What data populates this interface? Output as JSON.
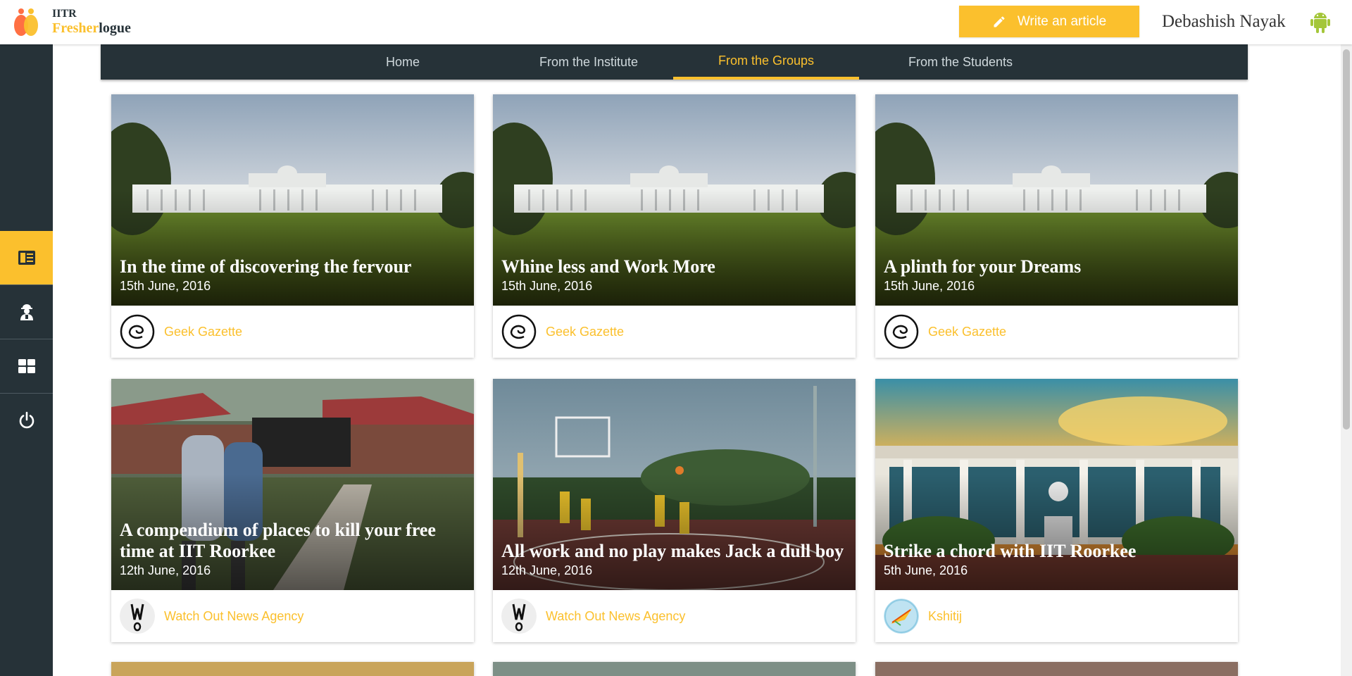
{
  "header": {
    "logo_top": "IITR",
    "logo_accent": "Fresher",
    "logo_rest": "logue",
    "write_label": "Write an article",
    "username": "Debashish Nayak"
  },
  "sidebar": {
    "items": [
      {
        "icon": "articles-icon",
        "active": true
      },
      {
        "icon": "agent-icon",
        "active": false
      },
      {
        "icon": "dashboard-icon",
        "active": false
      },
      {
        "icon": "power-icon",
        "active": false
      }
    ]
  },
  "nav": {
    "tabs": [
      {
        "label": "Home",
        "active": false
      },
      {
        "label": "From the Institute",
        "active": false
      },
      {
        "label": "From the Groups",
        "active": true
      },
      {
        "label": "From the Students",
        "active": false
      }
    ]
  },
  "cards": [
    {
      "title": "In the time of discovering the fervour",
      "date": "15th June, 2016",
      "group": "Geek Gazette"
    },
    {
      "title": "Whine less and Work More",
      "date": "15th June, 2016",
      "group": "Geek Gazette"
    },
    {
      "title": "A plinth for your Dreams",
      "date": "15th June, 2016",
      "group": "Geek Gazette"
    },
    {
      "title": "A compendium of places to kill your free time at IIT Roorkee",
      "date": "12th June, 2016",
      "group": "Watch Out News Agency"
    },
    {
      "title": "All work and no play makes Jack a dull boy",
      "date": "12th June, 2016",
      "group": "Watch Out News Agency"
    },
    {
      "title": "Strike a chord with IIT Roorkee",
      "date": "5th June, 2016",
      "group": "Kshitij"
    }
  ],
  "colors": {
    "accent": "#fbc02d",
    "dark": "#263238"
  }
}
